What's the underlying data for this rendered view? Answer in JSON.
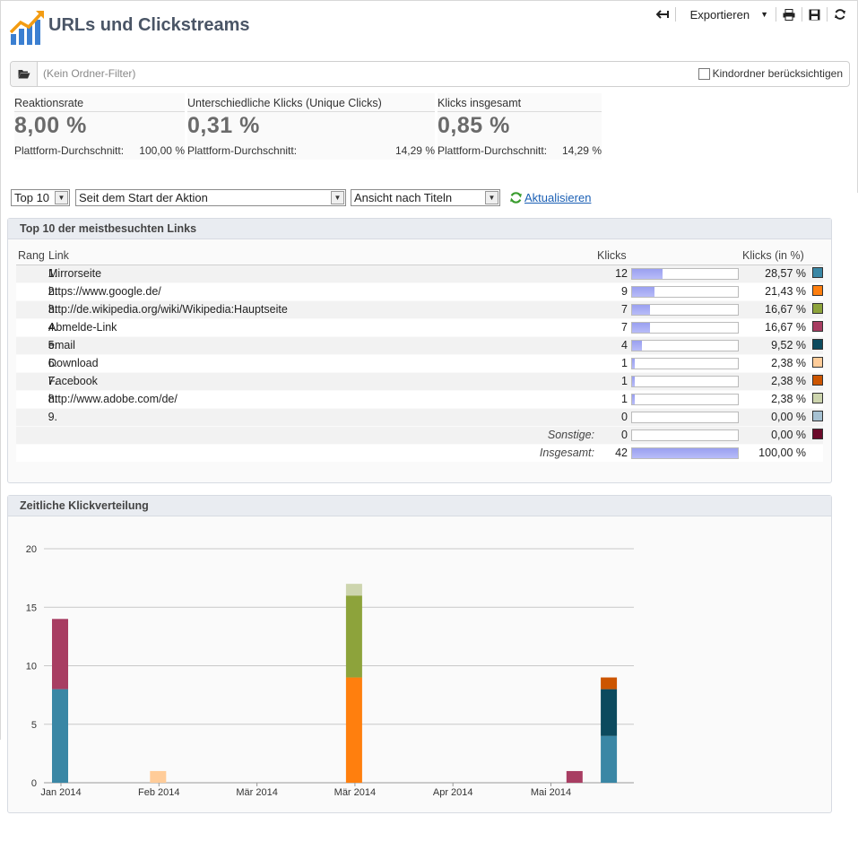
{
  "app": {
    "title": "URLs und Clickstreams"
  },
  "toolbar": {
    "export_label": "Exportieren"
  },
  "filter": {
    "placeholder": "(Kein Ordner-Filter)",
    "subfolder_label": "Kindordner berücksichtigen",
    "subfolder_checked": false
  },
  "kpis": [
    {
      "label": "Reaktionsrate",
      "value": "8,00 %",
      "avg_label": "Plattform-Durchschnitt:",
      "avg_value": "100,00 %"
    },
    {
      "label": "Unterschiedliche Klicks (Unique Clicks)",
      "value": "0,31 %",
      "avg_label": "Plattform-Durchschnitt:",
      "avg_value": "14,29 %"
    },
    {
      "label": "Klicks insgesamt",
      "value": "0,85 %",
      "avg_label": "Plattform-Durchschnitt:",
      "avg_value": "14,29 %"
    }
  ],
  "controls": {
    "top_select": "Top 10",
    "period_select": "Seit dem Start der Aktion",
    "view_select": "Ansicht nach Titeln",
    "refresh_label": "Aktualisieren"
  },
  "links_panel": {
    "title": "Top 10 der meistbesuchten Links",
    "headers": {
      "rank": "Rang",
      "link": "Link",
      "clicks": "Klicks",
      "clicks_pct": "Klicks (in %)"
    },
    "rows": [
      {
        "rank": "1.",
        "link": "Mirrorseite",
        "clicks": "12",
        "ratio": 0.2857,
        "pct": "28,57 %",
        "color": "#3a87a5"
      },
      {
        "rank": "2.",
        "link": "https://www.google.de/",
        "clicks": "9",
        "ratio": 0.2143,
        "pct": "21,43 %",
        "color": "#ff7f0e"
      },
      {
        "rank": "3.",
        "link": "http://de.wikipedia.org/wiki/Wikipedia:Hauptseite",
        "clicks": "7",
        "ratio": 0.1667,
        "pct": "16,67 %",
        "color": "#8da33b"
      },
      {
        "rank": "4.",
        "link": "Abmelde-Link",
        "clicks": "7",
        "ratio": 0.1667,
        "pct": "16,67 %",
        "color": "#a83d62"
      },
      {
        "rank": "5.",
        "link": "email",
        "clicks": "4",
        "ratio": 0.0952,
        "pct": "9,52 %",
        "color": "#0c4a5e"
      },
      {
        "rank": "6.",
        "link": "Download",
        "clicks": "1",
        "ratio": 0.0238,
        "pct": "2,38 %",
        "color": "#ffcc99"
      },
      {
        "rank": "7.",
        "link": "Facebook",
        "clicks": "1",
        "ratio": 0.0238,
        "pct": "2,38 %",
        "color": "#cc5500"
      },
      {
        "rank": "8.",
        "link": "http://www.adobe.com/de/",
        "clicks": "1",
        "ratio": 0.0238,
        "pct": "2,38 %",
        "color": "#cdd5ae"
      },
      {
        "rank": "9.",
        "link": "",
        "clicks": "0",
        "ratio": 0,
        "pct": "0,00 %",
        "color": "#a6c1d2"
      }
    ],
    "other": {
      "label": "Sonstige:",
      "clicks": "0",
      "ratio": 0,
      "pct": "0,00 %",
      "color": "#6b0a2a"
    },
    "total": {
      "label": "Insgesamt:",
      "clicks": "42",
      "ratio": 1,
      "pct": "100,00 %"
    }
  },
  "timeline_panel": {
    "title": "Zeitliche Klickverteilung"
  },
  "chart_data": {
    "type": "bar",
    "stacked": true,
    "ylim": [
      0,
      20
    ],
    "yticks": [
      0,
      5,
      10,
      15,
      20
    ],
    "xtick_labels": [
      "Jan 2014",
      "Feb 2014",
      "Mär 2014",
      "Mär 2014",
      "Apr 2014",
      "Mai 2014"
    ],
    "grid": true,
    "bars": [
      {
        "x_index": 0,
        "segments": [
          {
            "value": 8,
            "color": "#3a87a5"
          },
          {
            "value": 6,
            "color": "#a83d62"
          }
        ]
      },
      {
        "x_index": 1,
        "segments": [
          {
            "value": 1,
            "color": "#ffcc99"
          }
        ]
      },
      {
        "x_index": 3,
        "segments": [
          {
            "value": 9,
            "color": "#ff7f0e"
          },
          {
            "value": 7,
            "color": "#8da33b"
          },
          {
            "value": 1,
            "color": "#cdd5ae"
          }
        ]
      },
      {
        "x_index": 5.25,
        "segments": [
          {
            "value": 1,
            "color": "#a83d62"
          }
        ]
      },
      {
        "x_index": 5.6,
        "segments": [
          {
            "value": 4,
            "color": "#3a87a5"
          },
          {
            "value": 4,
            "color": "#0c4a5e"
          },
          {
            "value": 1,
            "color": "#cc5500"
          }
        ]
      }
    ]
  }
}
